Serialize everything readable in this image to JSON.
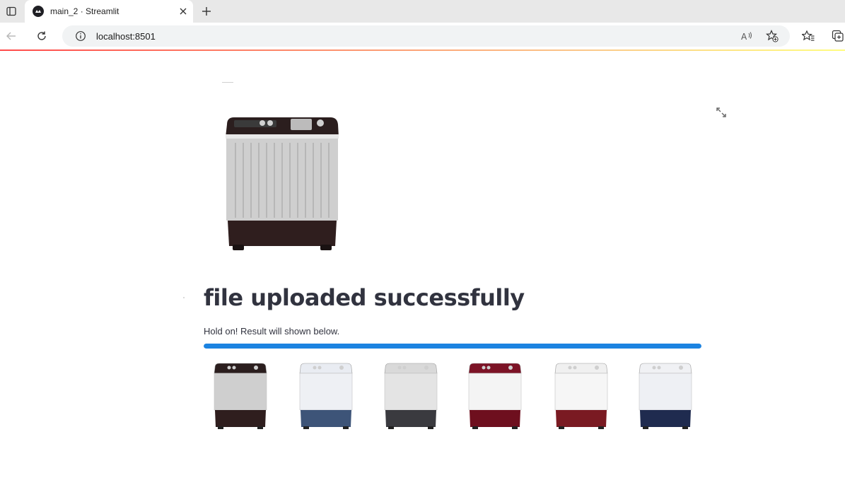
{
  "browser": {
    "tab_title": "main_2 · Streamlit",
    "url": "localhost:8501"
  },
  "app": {
    "heading": "file uploaded successfully",
    "status_text": "Hold on! Result will shown below.",
    "progress_fraction": 1.0,
    "uploaded_image": {
      "description": "twin-tub washing machine",
      "top_color": "#2b1e1e",
      "body_color": "#cfcfcf",
      "base_color": "#2f1e1e"
    },
    "results": [
      {
        "top_color": "#2b1e1e",
        "body_color": "#cfcfcf",
        "base_color": "#2f1e1e"
      },
      {
        "top_color": "#e9ecf2",
        "body_color": "#eef0f4",
        "base_color": "#3d5478"
      },
      {
        "top_color": "#d9d9d9",
        "body_color": "#e4e4e4",
        "base_color": "#3a3a3f"
      },
      {
        "top_color": "#7c1326",
        "body_color": "#f4f4f4",
        "base_color": "#6e0f1e"
      },
      {
        "top_color": "#f0f0f0",
        "body_color": "#f6f6f6",
        "base_color": "#7a1a22"
      },
      {
        "top_color": "#f0f1f4",
        "body_color": "#eef0f4",
        "base_color": "#1f2b4f"
      }
    ]
  },
  "colors": {
    "accent": "#1c83e1",
    "text": "#31333f"
  }
}
